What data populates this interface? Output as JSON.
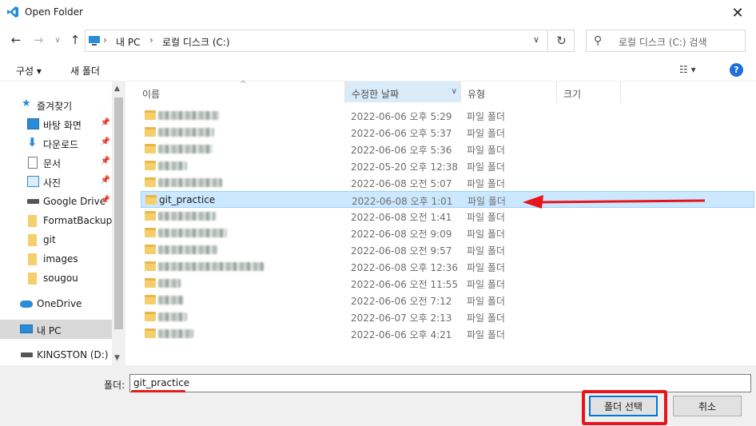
{
  "window": {
    "title": "Open Folder",
    "close_glyph": "✕"
  },
  "nav": {
    "breadcrumb": [
      "내 PC",
      "로컬 디스크 (C:)"
    ],
    "search_placeholder": "로컬 디스크 (C:) 검색"
  },
  "toolbar": {
    "organize": "구성",
    "new_folder": "새 폴더",
    "help": "?"
  },
  "sidebar": {
    "items": [
      {
        "label": "즐겨찾기",
        "icon": "star-icon",
        "pinned": false
      },
      {
        "label": "바탕 화면",
        "icon": "desktop-icon",
        "pinned": true
      },
      {
        "label": "다운로드",
        "icon": "download-icon",
        "pinned": true
      },
      {
        "label": "문서",
        "icon": "document-icon",
        "pinned": true
      },
      {
        "label": "사진",
        "icon": "pictures-icon",
        "pinned": true
      },
      {
        "label": "Google Drive",
        "icon": "drive-icon",
        "pinned": true
      },
      {
        "label": "FormatBackup",
        "icon": "folder-icon",
        "pinned": false
      },
      {
        "label": "git",
        "icon": "folder-icon",
        "pinned": false
      },
      {
        "label": "images",
        "icon": "folder-icon",
        "pinned": false
      },
      {
        "label": "sougou",
        "icon": "folder-icon",
        "pinned": false
      },
      {
        "label": "OneDrive",
        "icon": "cloud-icon",
        "pinned": false
      },
      {
        "label": "내 PC",
        "icon": "pc-icon",
        "pinned": false
      },
      {
        "label": "KINGSTON (D:)",
        "icon": "usb-drive-icon",
        "pinned": false
      }
    ]
  },
  "columns": {
    "name": "이름",
    "date": "수정한 날짜",
    "type": "유형",
    "size": "크기"
  },
  "files": [
    {
      "name": "",
      "date": "2022-06-06 오후 5:29",
      "type": "파일 폴더"
    },
    {
      "name": "",
      "date": "2022-06-06 오후 5:37",
      "type": "파일 폴더"
    },
    {
      "name": "",
      "date": "2022-06-06 오후 5:36",
      "type": "파일 폴더"
    },
    {
      "name": "",
      "date": "2022-05-20 오후 12:38",
      "type": "파일 폴더"
    },
    {
      "name": "",
      "date": "2022-06-08 오전 5:07",
      "type": "파일 폴더"
    },
    {
      "name": "git_practice",
      "date": "2022-06-08 오후 1:01",
      "type": "파일 폴더"
    },
    {
      "name": "",
      "date": "2022-06-08 오전 1:41",
      "type": "파일 폴더"
    },
    {
      "name": "",
      "date": "2022-06-08 오전 9:09",
      "type": "파일 폴더"
    },
    {
      "name": "",
      "date": "2022-06-08 오전 9:57",
      "type": "파일 폴더"
    },
    {
      "name": "",
      "date": "2022-06-08 오후 12:36",
      "type": "파일 폴더"
    },
    {
      "name": "",
      "date": "2022-06-06 오전 11:55",
      "type": "파일 폴더"
    },
    {
      "name": "",
      "date": "2022-06-06 오전 7:12",
      "type": "파일 폴더"
    },
    {
      "name": "",
      "date": "2022-06-07 오후 2:13",
      "type": "파일 폴더"
    },
    {
      "name": "",
      "date": "2022-06-06 오후 4:21",
      "type": "파일 폴더"
    }
  ],
  "footer": {
    "folder_label": "폴더:",
    "folder_value": "git_practice",
    "select_button": "폴더 선택",
    "cancel_button": "취소"
  },
  "colors": {
    "accent": "#0078d7",
    "selection": "#cce8ff",
    "annotation_red": "#e8141c"
  }
}
